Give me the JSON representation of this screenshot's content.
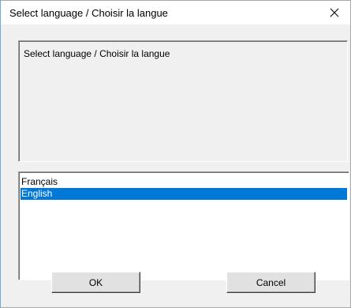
{
  "window": {
    "title": "Select language / Choisir la langue",
    "close_glyph": "✕",
    "close_icon": "close-icon"
  },
  "message": {
    "text": "Select language / Choisir la langue"
  },
  "language_list": {
    "items": [
      {
        "label": "Français",
        "selected": false
      },
      {
        "label": "English",
        "selected": true
      }
    ]
  },
  "buttons": {
    "ok_label": "OK",
    "cancel_label": "Cancel"
  },
  "colors": {
    "selection": "#0078d7",
    "selection_text": "#ffffff",
    "dialog_bg": "#f0f0f0",
    "titlebar_bg": "#ffffff"
  }
}
